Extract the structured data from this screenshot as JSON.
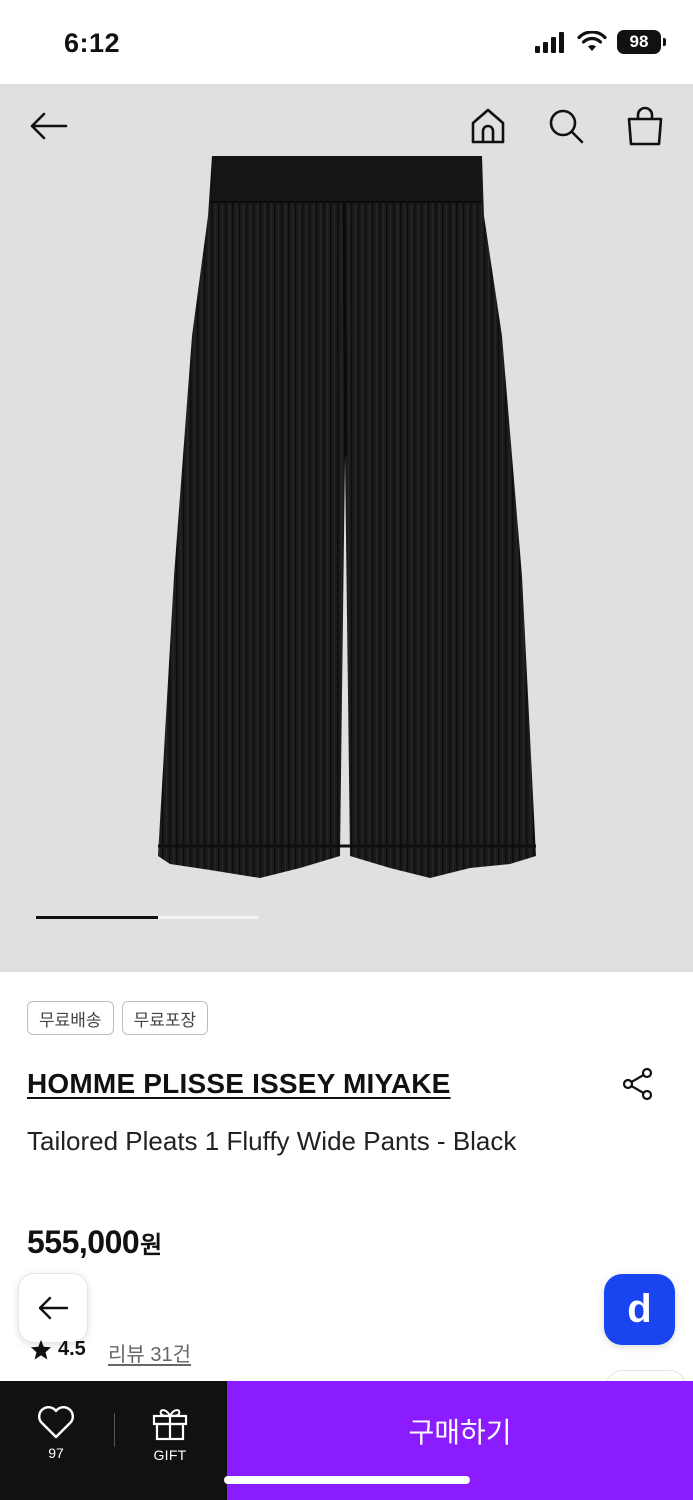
{
  "status_bar": {
    "time": "6:12",
    "battery": "98"
  },
  "product": {
    "carousel": {
      "current": 1,
      "total": 2,
      "progress": 0.55
    },
    "badges": [
      "무료배송",
      "무료포장"
    ],
    "brand": "HOMME PLISSE ISSEY MIYAKE",
    "name": "Tailored Pleats 1 Fluffy Wide Pants - Black",
    "price": "555,000",
    "price_unit": "원",
    "rating": "4.5",
    "review_link": "리뷰 31건"
  },
  "floating": {
    "d_label": "d"
  },
  "bottom_bar": {
    "like_count": "97",
    "gift_label": "GIFT",
    "buy_label": "구매하기",
    "buy_color": "#8a1cff"
  },
  "icons": [
    "back-arrow-icon",
    "home-icon",
    "search-icon",
    "shopping-bag-icon",
    "share-icon",
    "star-icon",
    "heart-icon",
    "gift-icon"
  ]
}
